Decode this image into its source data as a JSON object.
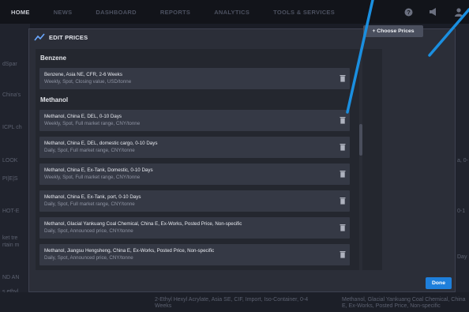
{
  "topbar": {
    "nav": [
      "HOME",
      "NEWS",
      "DASHBOARD",
      "REPORTS",
      "ANALYTICS",
      "TOOLS & SERVICES"
    ],
    "icons": [
      "help-icon",
      "megaphone-icon",
      "user-icon"
    ]
  },
  "background": {
    "left_texts": [
      "dSpar",
      "China's",
      "ICPL ch",
      "LOOK",
      "PI|E|S",
      "HOT-E",
      "ket tre",
      "rtain m",
      "ND AN",
      "s ethyl"
    ],
    "right_texts": [
      "a, 0-",
      "0-1",
      "Day"
    ],
    "bottom": {
      "center": "2-Ethyl Hexyl Acrylate, Asia SE, CIF, Import, Iso-Container, 0-4 Weeks",
      "right": "Methanol, Glacial Yankuang Coal Chemical, China E, Ex-Works, Posted Price, Non-specific"
    }
  },
  "modal": {
    "title": "EDIT PRICES",
    "sections": [
      {
        "heading": "Benzene",
        "items": [
          {
            "title": "Benzene, Asia NE, CFR, 2-6 Weeks",
            "subtitle": "Weekly, Spot, Closing value, USD/tonne"
          }
        ]
      },
      {
        "heading": "Methanol",
        "items": [
          {
            "title": "Methanol, China E, DEL, 0-10 Days",
            "subtitle": "Weekly, Spot, Full market range, CNY/tonne"
          },
          {
            "title": "Methanol, China E, DEL, domestic cargo, 0-10 Days",
            "subtitle": "Daily, Spot, Full market range, CNY/tonne"
          },
          {
            "title": "Methanol, China E, Ex-Tank, Domestic, 0-10 Days",
            "subtitle": "Weekly, Spot, Full market range, CNY/tonne"
          },
          {
            "title": "Methanol, China E, Ex-Tank, port, 0-10 Days",
            "subtitle": "Daily, Spot, Full market range, CNY/tonne"
          },
          {
            "title": "Methanol, Glacial Yankuang Coal Chemical, China E, Ex-Works, Posted Price, Non-specific",
            "subtitle": "Daily, Spot, Announced price, CNY/tonne"
          },
          {
            "title": "Methanol, Jiangsu Hengsheng, China E, Ex-Works, Posted Price, Non-specific",
            "subtitle": "Daily, Spot, Announced price, CNY/tonne"
          }
        ]
      }
    ],
    "choose_prices_label": "+ Choose Prices",
    "done_label": "Done"
  },
  "colors": {
    "accent": "#1e7fdb",
    "annotation_line": "#1a8fe0"
  }
}
